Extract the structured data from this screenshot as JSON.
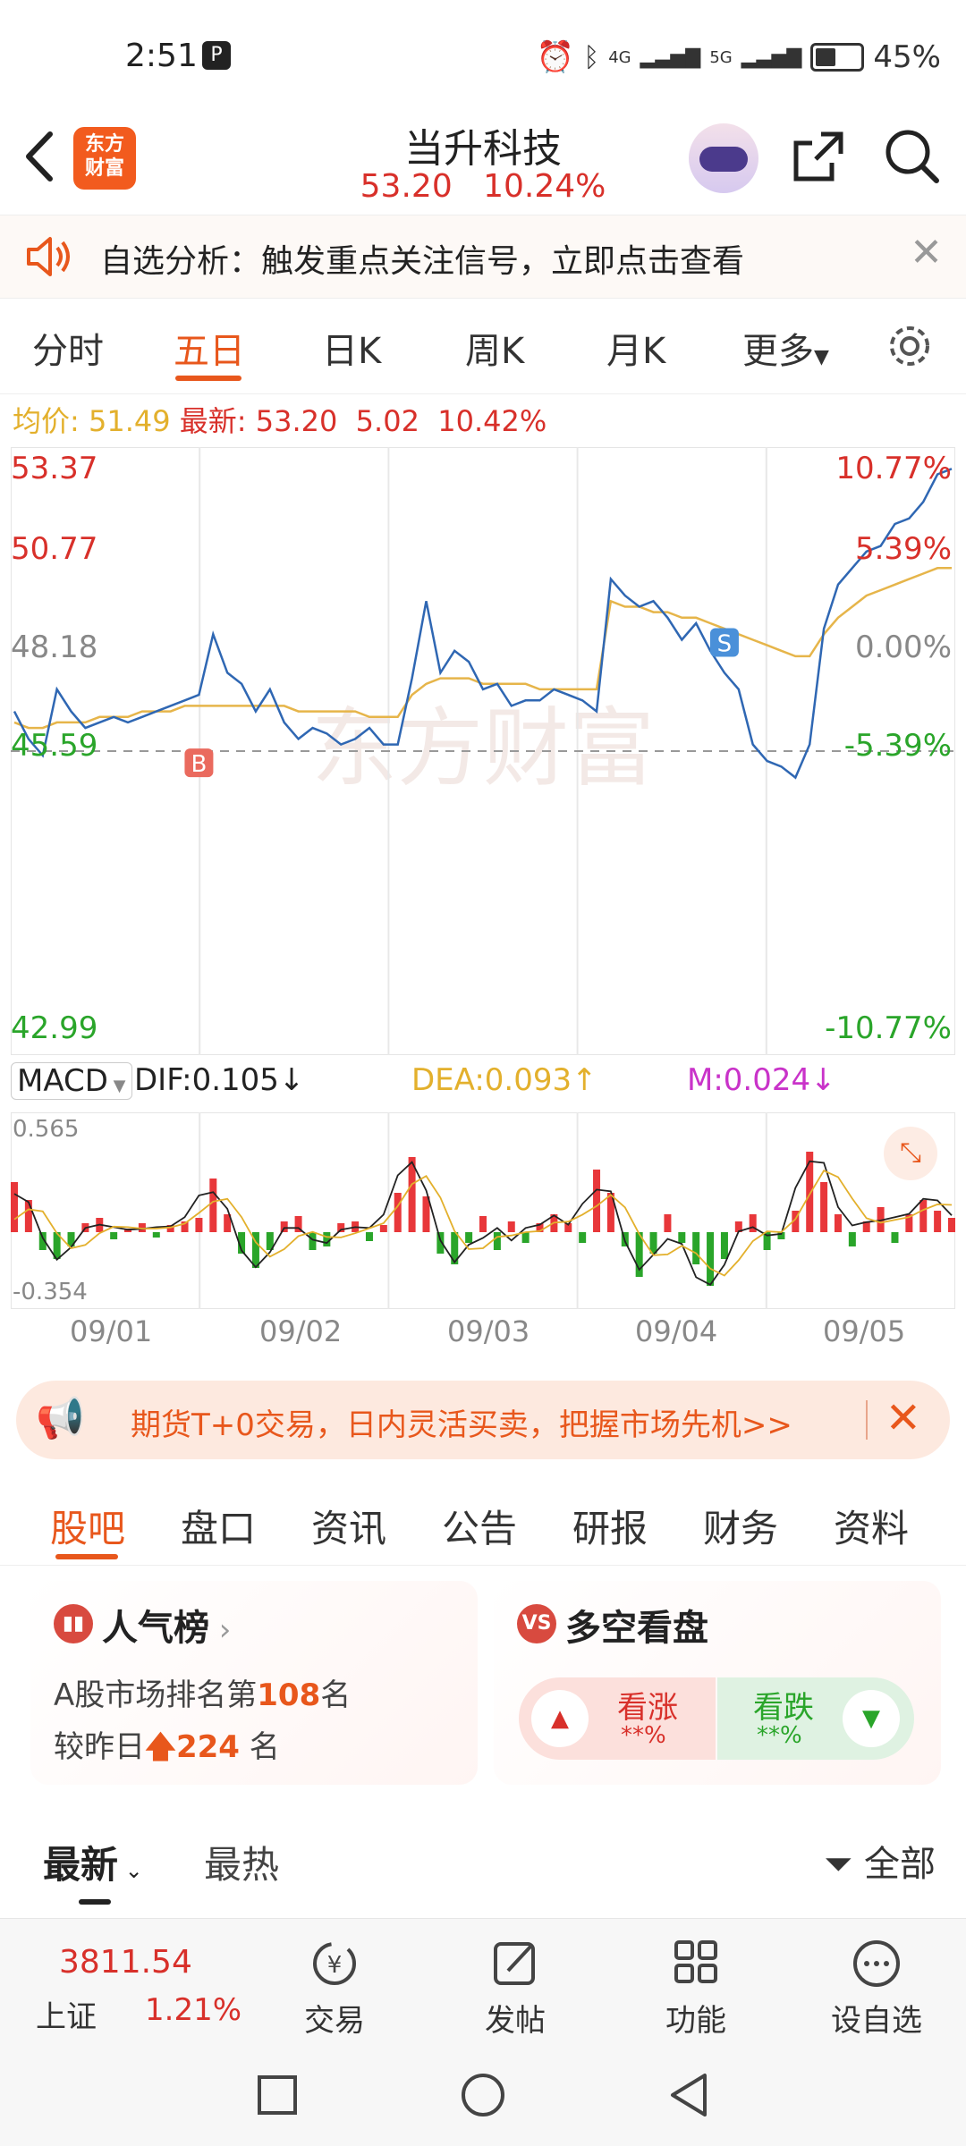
{
  "status": {
    "time": "2:51",
    "battery": "45%",
    "battery_level": 0.45,
    "net1": "4G",
    "net2": "5G"
  },
  "header": {
    "stock_name": "当升科技",
    "price": "53.20",
    "change_pct": "10.24%",
    "logo_line1": "东方",
    "logo_line2": "财富"
  },
  "notice": {
    "text": "自选分析：触发重点关注信号，立即点击查看"
  },
  "chart_tabs": [
    "分时",
    "五日",
    "日K",
    "周K",
    "月K",
    "更多"
  ],
  "info": {
    "avg_label": "均价:",
    "avg": "51.49",
    "latest_label": "最新:",
    "latest": "53.20",
    "change": "5.02",
    "pct": "10.42%"
  },
  "chart_data": {
    "type": "line",
    "x": [
      "09/01",
      "09/02",
      "09/03",
      "09/04",
      "09/05"
    ],
    "y_ticks_left": [
      "53.37",
      "50.77",
      "48.18",
      "45.59",
      "42.99"
    ],
    "y_ticks_right": [
      "10.77%",
      "5.39%",
      "0.00%",
      "-5.39%",
      "-10.77%"
    ],
    "ylim": [
      42.99,
      53.37
    ],
    "base": 48.18,
    "watermark": "东方财富",
    "price": [
      48.9,
      48.4,
      48.1,
      49.3,
      48.9,
      48.6,
      48.7,
      48.8,
      48.7,
      48.8,
      48.9,
      49.0,
      49.1,
      49.2,
      50.3,
      49.6,
      49.4,
      48.9,
      49.3,
      48.7,
      48.4,
      48.6,
      48.5,
      48.3,
      48.4,
      48.6,
      48.3,
      48.3,
      49.5,
      50.9,
      49.6,
      50.0,
      49.8,
      49.3,
      49.4,
      49.0,
      49.1,
      49.1,
      49.3,
      49.2,
      49.1,
      48.9,
      51.3,
      51.0,
      50.8,
      50.9,
      50.6,
      50.2,
      50.5,
      50.0,
      49.6,
      49.3,
      48.3,
      48.0,
      47.9,
      47.7,
      48.3,
      50.4,
      51.2,
      51.5,
      51.8,
      51.9,
      52.3,
      52.4,
      52.7,
      53.2,
      53.3
    ],
    "avg_line": [
      48.7,
      48.6,
      48.6,
      48.7,
      48.7,
      48.7,
      48.8,
      48.8,
      48.8,
      48.9,
      48.9,
      48.9,
      49.0,
      49.0,
      49.0,
      49.0,
      49.0,
      49.0,
      49.0,
      49.0,
      48.9,
      48.9,
      48.9,
      48.9,
      48.9,
      48.8,
      48.8,
      48.8,
      49.2,
      49.4,
      49.5,
      49.5,
      49.5,
      49.4,
      49.4,
      49.4,
      49.4,
      49.3,
      49.3,
      49.3,
      49.3,
      49.3,
      50.9,
      50.8,
      50.8,
      50.7,
      50.7,
      50.6,
      50.6,
      50.5,
      50.4,
      50.3,
      50.2,
      50.1,
      50.0,
      49.9,
      49.9,
      50.3,
      50.6,
      50.8,
      51.0,
      51.1,
      51.2,
      51.3,
      51.4,
      51.5,
      51.5
    ],
    "markers": [
      {
        "label": "B",
        "day": "09/02"
      },
      {
        "label": "S",
        "day": "09/04"
      }
    ]
  },
  "macd": {
    "select": "MACD",
    "dif_label": "DIF:0.105",
    "dea_label": "DEA:0.093",
    "m_label": "M:0.024",
    "ymax": "0.565",
    "ymin": "-0.354",
    "bars": [
      0.28,
      0.18,
      -0.1,
      -0.15,
      -0.08,
      0.05,
      0.08,
      -0.04,
      0.02,
      0.05,
      -0.03,
      0.04,
      0.06,
      0.08,
      0.3,
      0.1,
      -0.12,
      -0.2,
      -0.1,
      0.06,
      0.09,
      -0.1,
      -0.08,
      0.05,
      0.06,
      -0.05,
      0.04,
      0.22,
      0.42,
      0.2,
      -0.12,
      -0.18,
      -0.06,
      0.09,
      -0.1,
      0.06,
      -0.06,
      0.05,
      0.1,
      0.05,
      -0.06,
      0.35,
      0.22,
      -0.08,
      -0.25,
      -0.12,
      0.1,
      -0.06,
      -0.18,
      -0.3,
      -0.15,
      0.06,
      0.1,
      -0.1,
      -0.04,
      0.12,
      0.45,
      0.28,
      0.1,
      -0.08,
      0.06,
      0.14,
      -0.06,
      0.1,
      0.18,
      0.12,
      0.08
    ],
    "colors": {
      "dif": "#222222",
      "dea": "#e3b02c",
      "m": "#c933c9",
      "up": "#e8373a",
      "down": "#2aa52a"
    }
  },
  "ad": {
    "text": "期货T+0交易，日内灵活买卖，把握市场先机>>"
  },
  "sections": [
    "股吧",
    "盘口",
    "资讯",
    "公告",
    "研报",
    "财务",
    "资料"
  ],
  "popularity": {
    "title": "人气榜",
    "rank_prefix": "A股市场排名第",
    "rank": "108",
    "rank_suffix": "名",
    "change_prefix": "较昨日",
    "change": "224",
    "change_suffix": "名"
  },
  "longshort": {
    "title": "多空看盘",
    "bull_label": "看涨",
    "bull_value": "**%",
    "bear_label": "看跌",
    "bear_value": "**%"
  },
  "filters": {
    "newest": "最新",
    "hottest": "最热",
    "all": "全部"
  },
  "bottom_nav": {
    "index_value": "3811.54",
    "index_name": "上证",
    "index_pct": "1.21%",
    "trade": "交易",
    "post": "发帖",
    "functions": "功能",
    "watchlist": "设自选"
  }
}
